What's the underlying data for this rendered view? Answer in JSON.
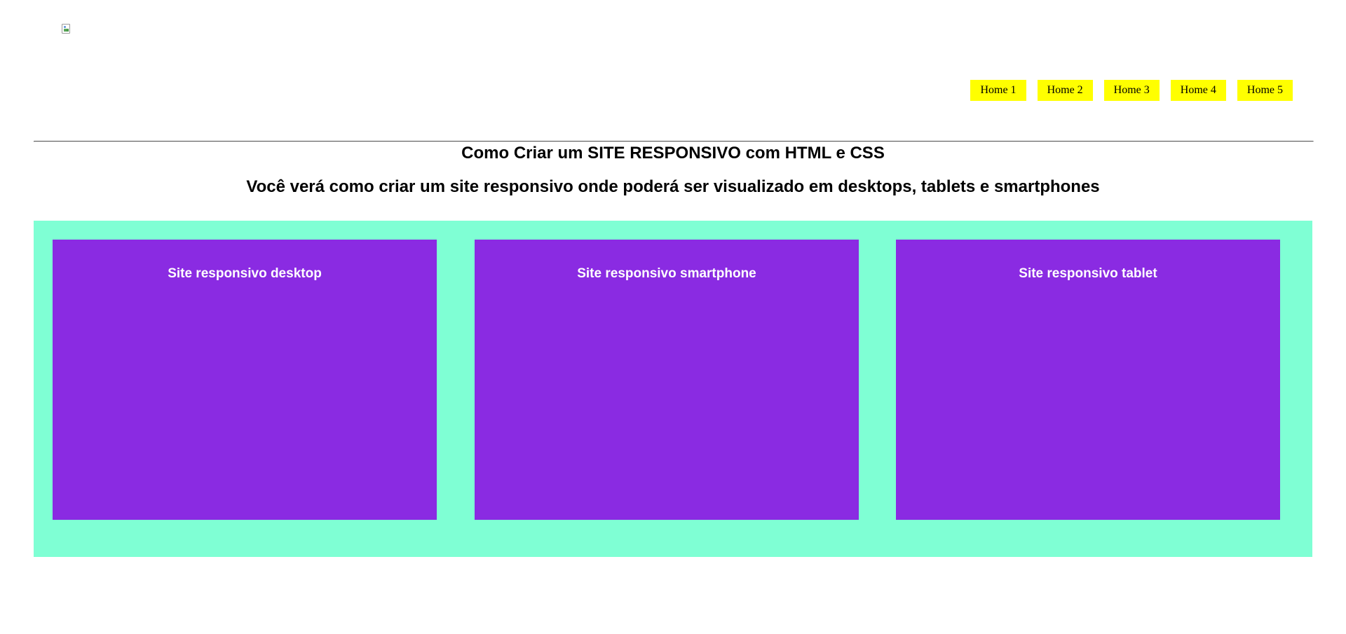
{
  "header": {
    "logo_icon": "broken-image-icon",
    "nav": [
      {
        "label": "Home 1"
      },
      {
        "label": "Home 2"
      },
      {
        "label": "Home 3"
      },
      {
        "label": "Home 4"
      },
      {
        "label": "Home 5"
      }
    ]
  },
  "main": {
    "title": "Como Criar um SITE RESPONSIVO com HTML e CSS",
    "subtitle": "Você verá como criar um site responsivo onde poderá ser visualizado em desktops, tablets e smartphones",
    "cards": [
      {
        "title": "Site responsivo desktop"
      },
      {
        "title": "Site responsivo smartphone"
      },
      {
        "title": "Site responsivo tablet"
      }
    ]
  },
  "colors": {
    "nav_background": "#ffff00",
    "container_background": "#7fffd4",
    "card_background": "#8a2be2",
    "card_text": "#ffffff"
  }
}
